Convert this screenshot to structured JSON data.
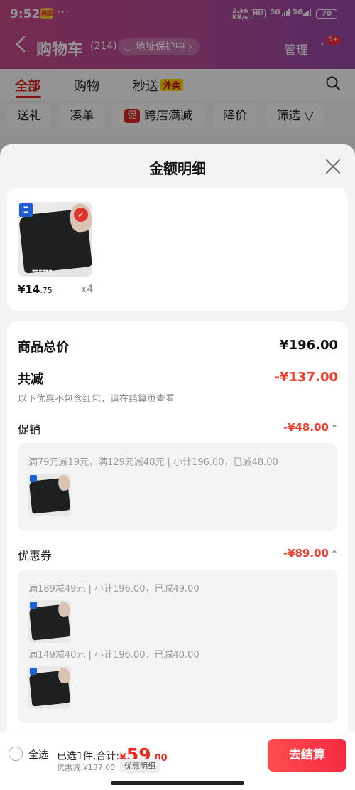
{
  "status_bar": {
    "time": "9:52",
    "app_icon_text": "美团",
    "dots": "···",
    "speed_top": "2.36",
    "speed_bottom": "KB/s",
    "hd": "HD",
    "signal_1": "5G",
    "signal_2": "5G",
    "battery": "70"
  },
  "header": {
    "back_icon": "chevron-left-icon",
    "title": "购物车",
    "count": "(214)",
    "address_protection": "地址保护中",
    "manage": "管理",
    "more_badge": "5+"
  },
  "tabs": [
    {
      "label": "全部",
      "active": true
    },
    {
      "label": "购物",
      "active": false
    },
    {
      "label": "秒送",
      "active": false,
      "tag": "外卖"
    }
  ],
  "filters": {
    "gift": "送礼",
    "bundle": "凑单",
    "promo_icon": "促",
    "cross_store": "跨店满减",
    "price_drop": "降价",
    "filter": "筛选"
  },
  "sheet": {
    "title": "金额明细",
    "close_icon": "close-icon",
    "product": {
      "price_int": "¥14",
      "price_dec": ".75",
      "qty": "x4"
    },
    "total_label": "商品总价",
    "total_value": "¥196.00",
    "reduce_label": "共减",
    "reduce_value": "-¥137.00",
    "reduce_hint": "以下优惠不包含红包，请在结算页查看",
    "promo_label": "促销",
    "promo_value": "-¥48.00",
    "promo_line": "满79元减19元，满129元减48元 | 小计196.00，已减48.00",
    "coupon_label": "优惠券",
    "coupon_value": "-¥89.00",
    "coupon_line_1": "满189减49元 | 小计196.00，已减49.00",
    "coupon_line_2": "满149减40元 | 小计196.00，已减40.00"
  },
  "bottom": {
    "select_all": "全选",
    "selected_prefix": "已选1件,合计:",
    "total_currency": "¥",
    "total_int": "59",
    "total_dec": ".00",
    "discount": "优惠减:¥137.00",
    "detail": "优惠明细",
    "checkout": "去结算"
  },
  "colors": {
    "accent_red": "#ec3b2b",
    "header_gradient_start": "#c94a8a",
    "header_gradient_end": "#9a4aaa"
  }
}
